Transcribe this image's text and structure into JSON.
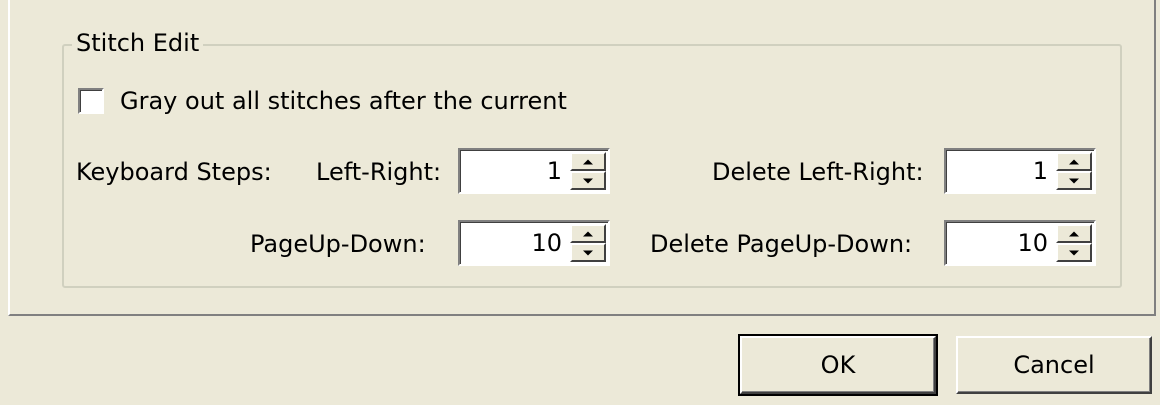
{
  "group": {
    "title": "Stitch Edit"
  },
  "checkbox": {
    "label": "Gray out all stitches after the current",
    "checked": false
  },
  "keyboard_steps_label": "Keyboard Steps:",
  "fields": {
    "left_right": {
      "label": "Left-Right:",
      "value": "1"
    },
    "page_up_down": {
      "label": "PageUp-Down:",
      "value": "10"
    },
    "delete_left_right": {
      "label": "Delete Left-Right:",
      "value": "1"
    },
    "delete_page_up_down": {
      "label": "Delete PageUp-Down:",
      "value": "10"
    }
  },
  "buttons": {
    "ok": "OK",
    "cancel": "Cancel"
  },
  "colors": {
    "face": "#ece9d8",
    "highlight": "#ffffff",
    "shadow": "#808080",
    "group_border": "#d0d0bf"
  }
}
